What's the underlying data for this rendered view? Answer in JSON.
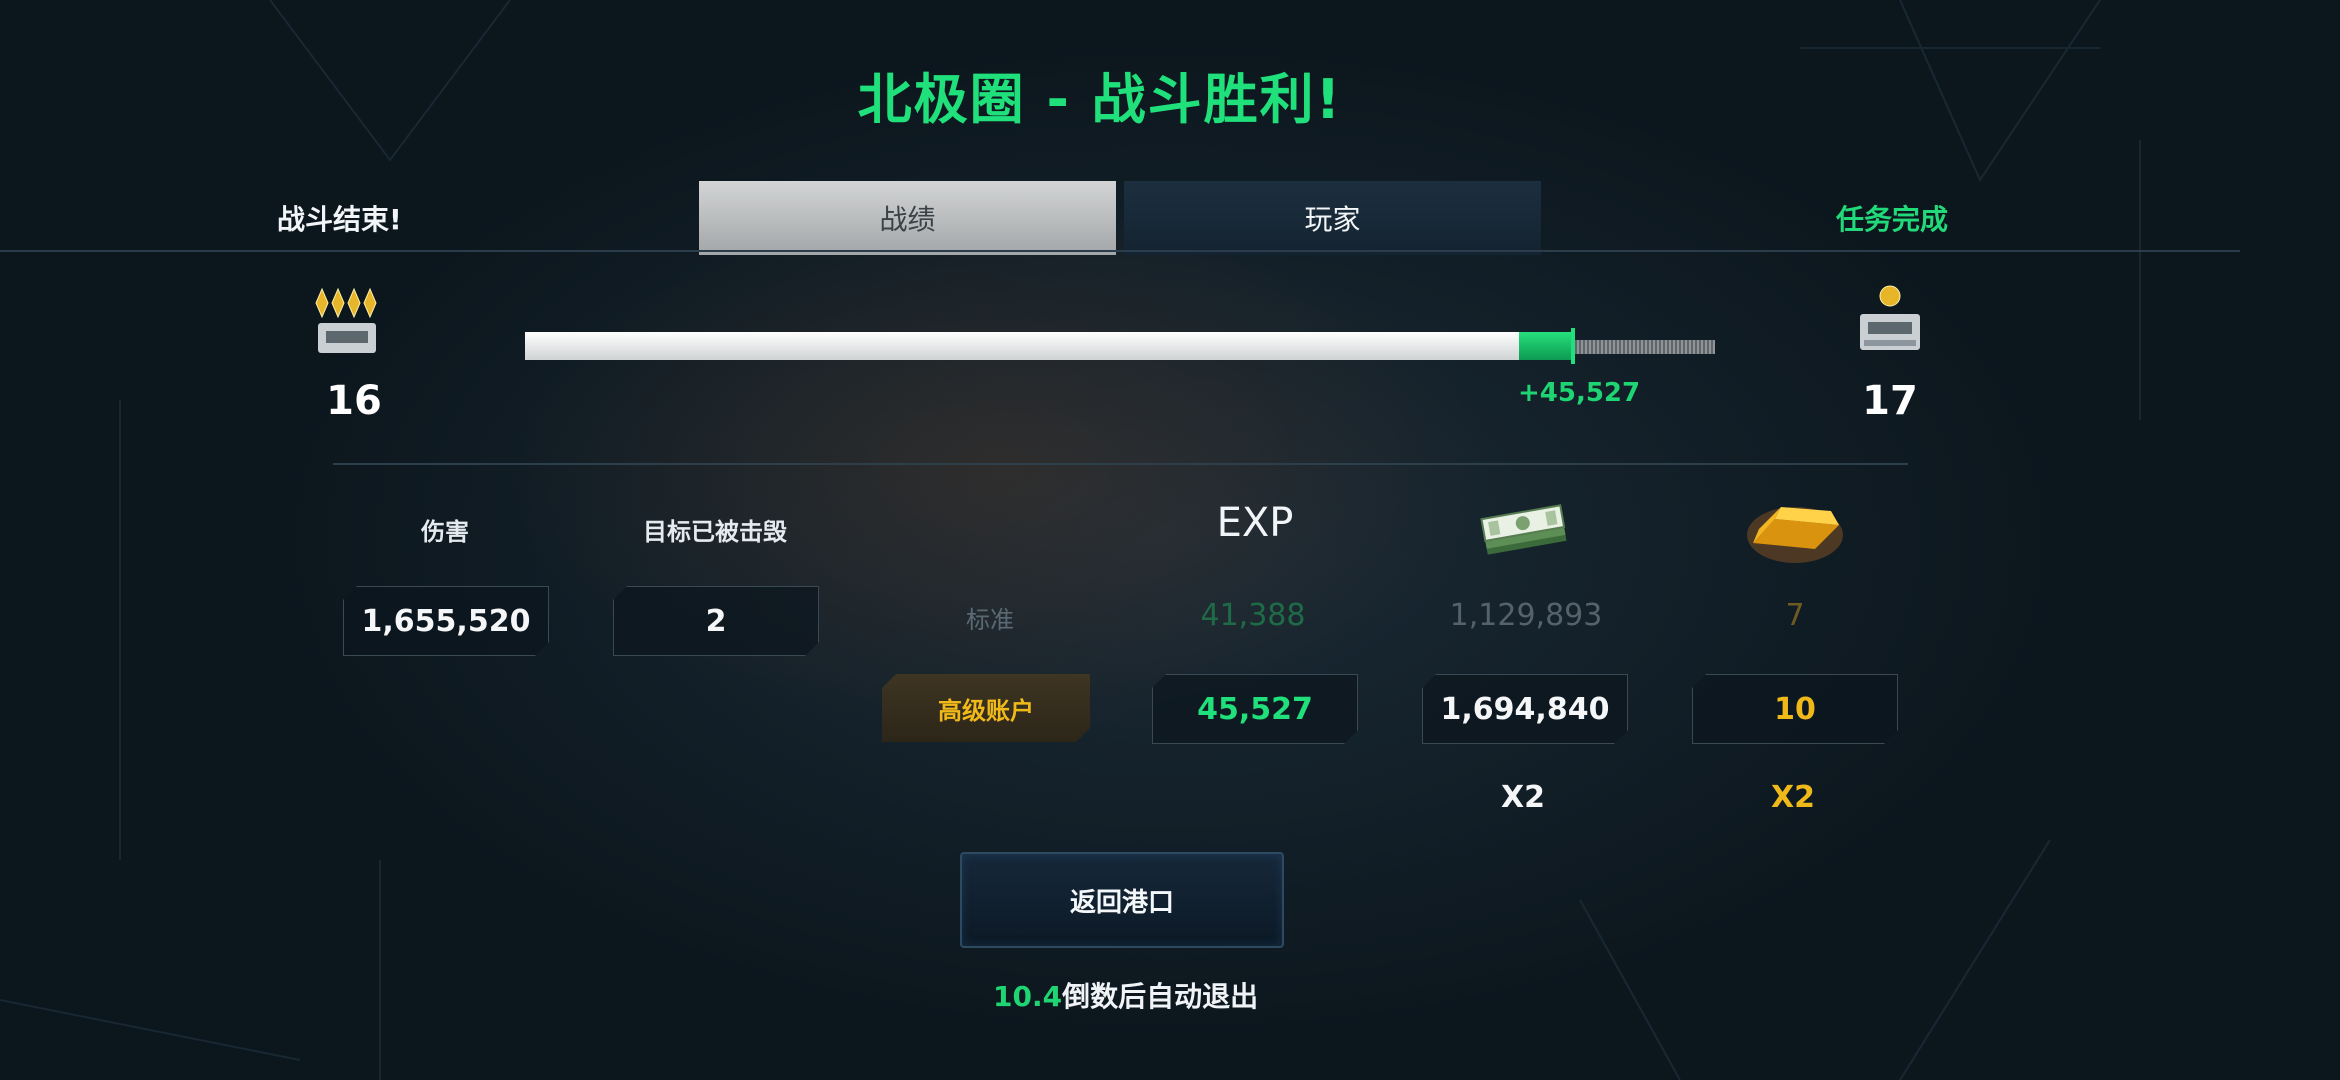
{
  "title": "北极圈 - 战斗胜利!",
  "header": {
    "left_label": "战斗结束!",
    "right_label": "任务完成",
    "tabs": [
      {
        "label": "战绩",
        "active": true
      },
      {
        "label": "玩家",
        "active": false
      }
    ]
  },
  "rank": {
    "current": "16",
    "next": "17"
  },
  "exp_bar": {
    "previous_fraction": 0.835,
    "gained_fraction": 0.045,
    "gain_text": "+45,527"
  },
  "stats": {
    "damage_label": "伤害",
    "damage_value": "1,655,520",
    "kills_label": "目标已被击毁",
    "kills_value": "2"
  },
  "rewards": {
    "exp_header": "EXP",
    "cash_icon": "cash-stack-icon",
    "gold_icon": "gold-bar-icon",
    "standard_label": "标准",
    "standard": {
      "exp": "41,388",
      "cash": "1,129,893",
      "gold": "7"
    },
    "premium_label": "高级账户",
    "premium": {
      "exp": "45,527",
      "cash": "1,694,840",
      "gold": "10"
    },
    "multipliers": {
      "cash": "X2",
      "gold": "X2"
    }
  },
  "actions": {
    "return_button": "返回港口"
  },
  "countdown": {
    "seconds": "10.4",
    "text": "倒数后自动退出"
  },
  "colors": {
    "accent_green": "#1fe07a",
    "premium_gold": "#f0b91a",
    "background": "#132029"
  }
}
